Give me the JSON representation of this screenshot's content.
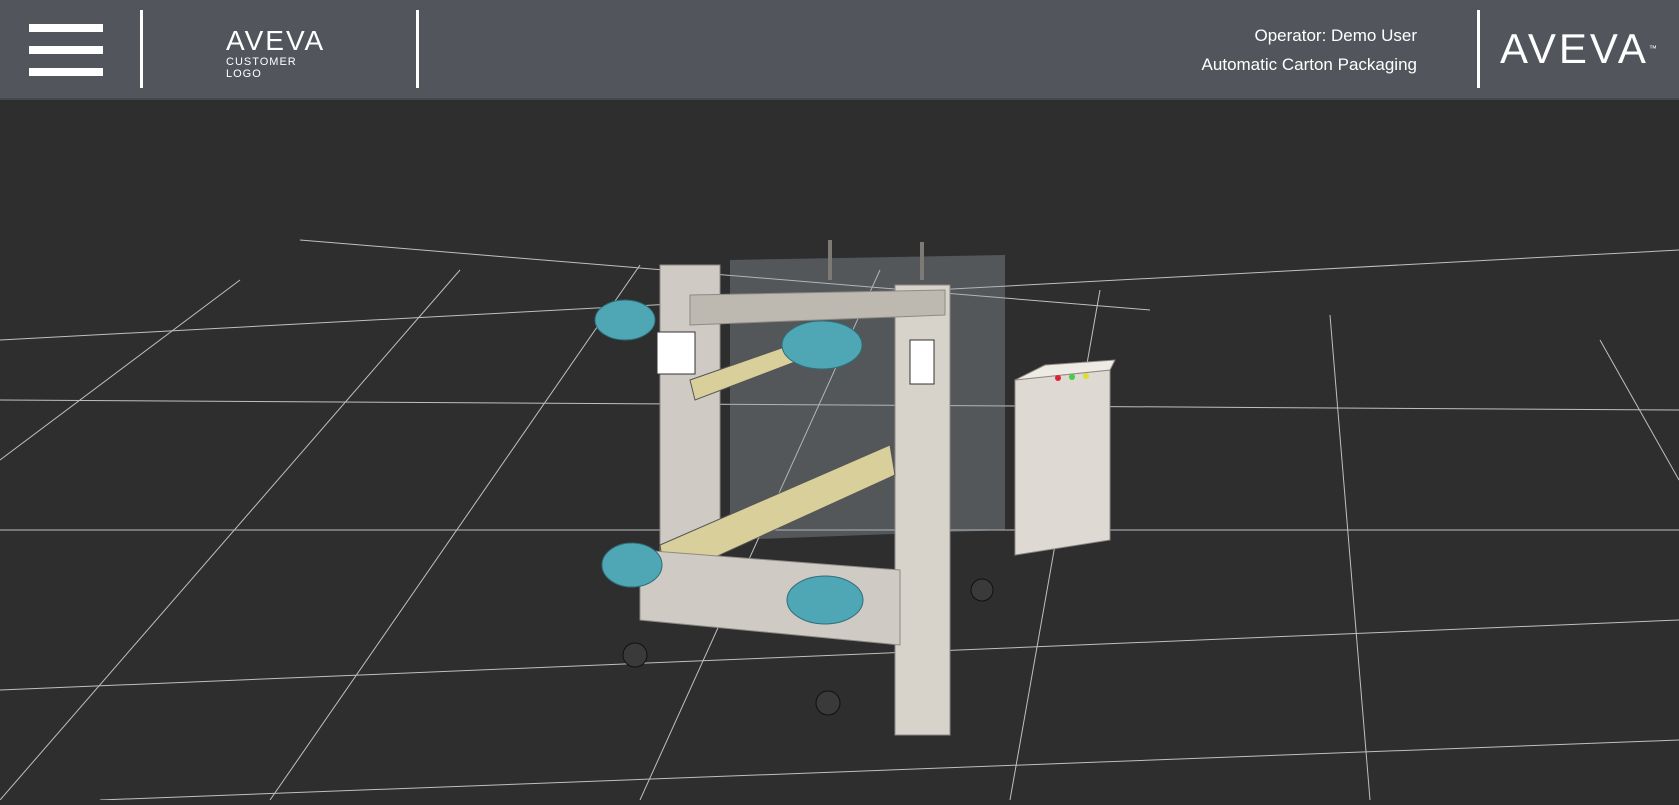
{
  "header": {
    "menu_icon": "hamburger-menu-icon",
    "customer_logo": {
      "brand": "AVEVA",
      "sub": "CUSTOMER LOGO"
    },
    "operator_label": "Operator: Demo User",
    "process_name": "Automatic Carton Packaging",
    "brand_logo": "AVEVA"
  },
  "viewport": {
    "model": "automatic-carton-packaging-machine",
    "background_color": "#2e2e2f",
    "grid_color": "#d9d9d9"
  }
}
